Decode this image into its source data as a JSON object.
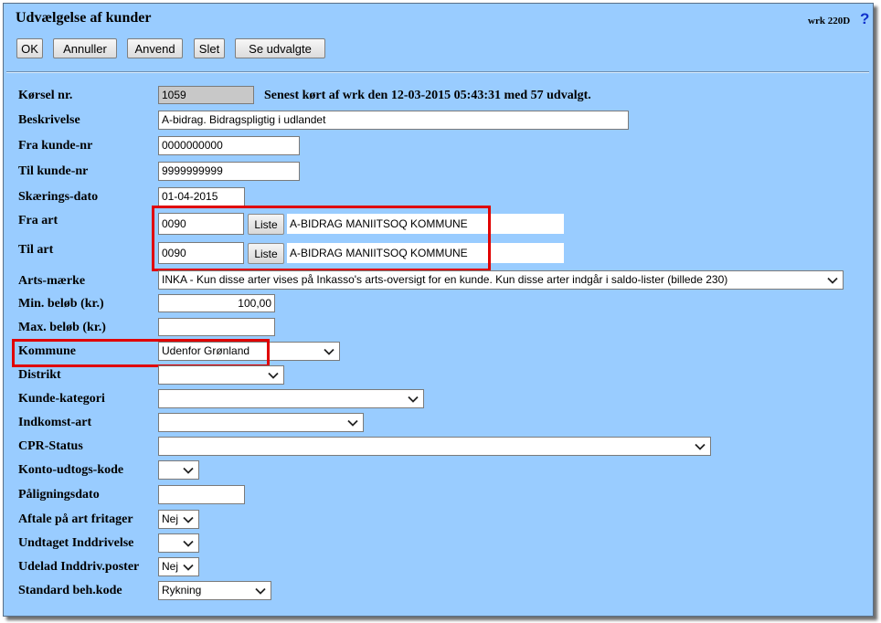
{
  "window": {
    "title": "Udvælgelse af kunder",
    "screen_code": "wrk 220D",
    "help_label": "?"
  },
  "toolbar": {
    "ok_label": "OK",
    "cancel_label": "Annuller",
    "apply_label": "Anvend",
    "delete_label": "Slet",
    "show_selected_label": "Se udvalgte"
  },
  "form": {
    "korsel": {
      "label": "Kørsel nr.",
      "value": "1059",
      "last_run": "Senest kørt af wrk den 12-03-2015 05:43:31 med 57 udvalgt."
    },
    "beskrivelse": {
      "label": "Beskrivelse",
      "value": "A-bidrag. Bidragspligtig i udlandet"
    },
    "fra_kunde": {
      "label": "Fra kunde-nr",
      "value": "0000000000"
    },
    "til_kunde": {
      "label": "Til kunde-nr",
      "value": "9999999999"
    },
    "skaerings_dato": {
      "label": "Skærings-dato",
      "value": "01-04-2015"
    },
    "fra_art": {
      "label": "Fra art",
      "value": "0090",
      "button": "Liste",
      "name": "A-BIDRAG MANIITSOQ KOMMUNE"
    },
    "til_art": {
      "label": "Til art",
      "value": "0090",
      "button": "Liste",
      "name": "A-BIDRAG MANIITSOQ KOMMUNE"
    },
    "arts_maerke": {
      "label": "Arts-mærke",
      "value": "INKA - Kun disse arter vises på Inkasso's arts-oversigt for en kunde. Kun disse arter indgår i saldo-lister (billede 230)"
    },
    "min_belob": {
      "label": "Min. beløb (kr.)",
      "value": "100,00"
    },
    "max_belob": {
      "label": "Max. beløb (kr.)",
      "value": ""
    },
    "kommune": {
      "label": "Kommune",
      "value": "Udenfor Grønland"
    },
    "distrikt": {
      "label": "Distrikt",
      "value": ""
    },
    "kunde_kategori": {
      "label": "Kunde-kategori",
      "value": ""
    },
    "indkomst_art": {
      "label": "Indkomst-art",
      "value": ""
    },
    "cpr_status": {
      "label": "CPR-Status",
      "value": ""
    },
    "konto_udtogs_kode": {
      "label": "Konto-udtogs-kode",
      "value": ""
    },
    "paligningsdato": {
      "label": "Påligningsdato",
      "value": ""
    },
    "aftale": {
      "label": "Aftale på art fritager",
      "value": "Nej"
    },
    "undtaget": {
      "label": "Undtaget Inddrivelse",
      "value": ""
    },
    "udelad": {
      "label": "Udelad Inddriv.poster",
      "value": "Nej"
    },
    "standard_beh": {
      "label": "Standard beh.kode",
      "value": "Rykning"
    }
  },
  "colors": {
    "window_bg": "#99ccff",
    "highlight": "#e00000",
    "help_icon": "#1133cc"
  },
  "icons": {
    "dropdown": "chevron-down-icon",
    "help": "help-icon"
  }
}
